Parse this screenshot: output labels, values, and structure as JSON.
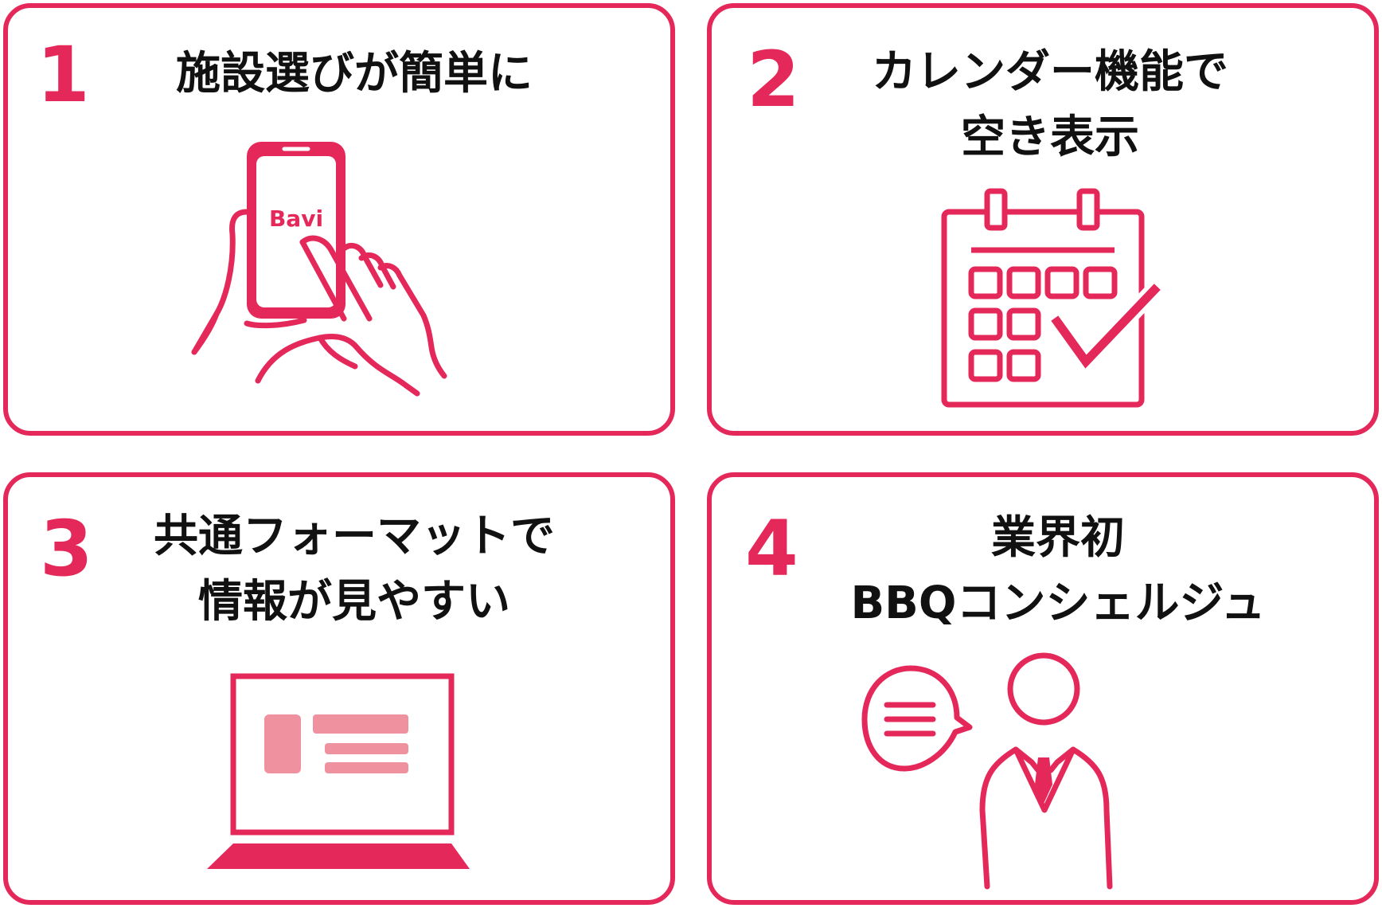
{
  "colors": {
    "accent": "#e5285a",
    "accent_light": "#f0919f",
    "text": "#111111",
    "background": "#ffffff"
  },
  "cards": [
    {
      "number": "1",
      "title_lines": [
        "施設選びが簡単に"
      ],
      "icon": "smartphone-hand-icon",
      "app_name": "Bavi"
    },
    {
      "number": "2",
      "title_lines": [
        "カレンダー機能で",
        "空き表示"
      ],
      "icon": "calendar-check-icon"
    },
    {
      "number": "3",
      "title_lines": [
        "共通フォーマットで",
        "情報が見やすい"
      ],
      "icon": "laptop-icon"
    },
    {
      "number": "4",
      "title_lines": [
        "業界初",
        "BBQコンシェルジュ"
      ],
      "icon": "concierge-speech-icon"
    }
  ]
}
